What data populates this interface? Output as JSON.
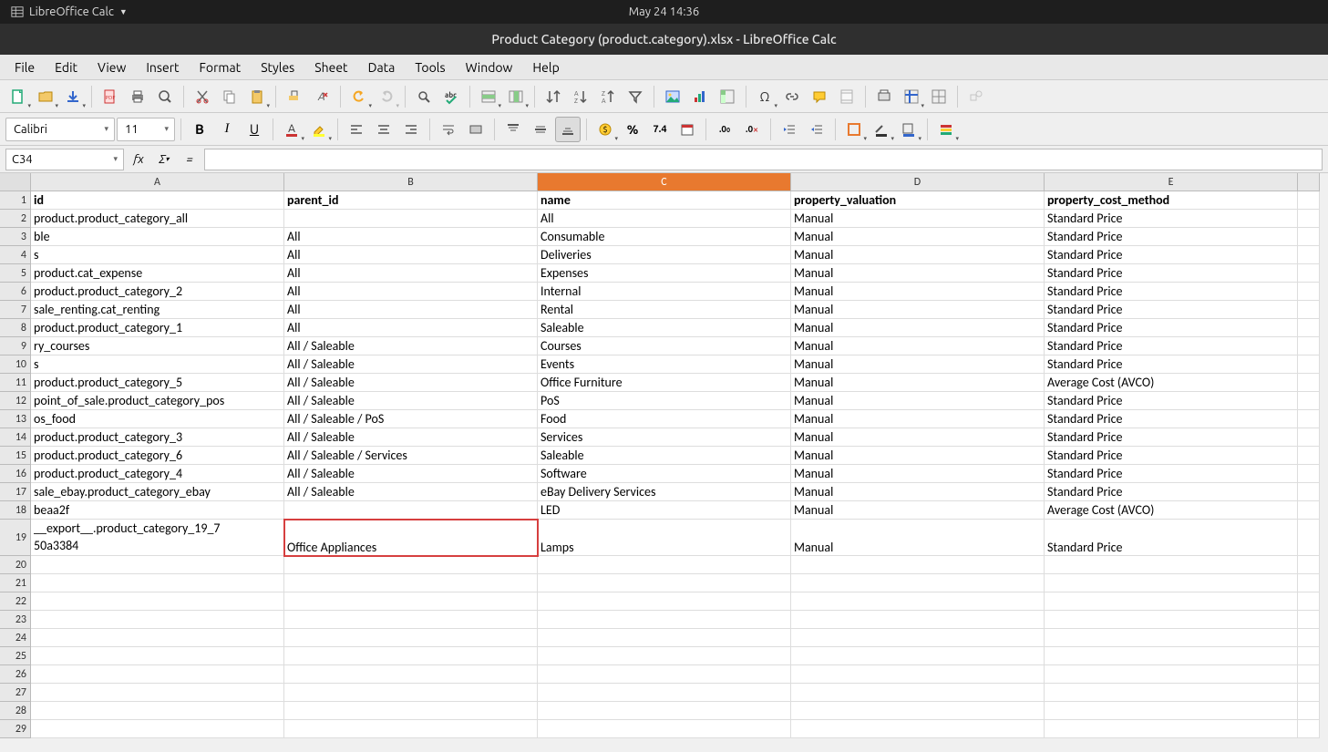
{
  "system": {
    "app_name": "LibreOffice Calc",
    "clock": "May 24  14:36"
  },
  "window": {
    "title": "Product Category (product.category).xlsx - LibreOffice Calc"
  },
  "menu": [
    "File",
    "Edit",
    "View",
    "Insert",
    "Format",
    "Styles",
    "Sheet",
    "Data",
    "Tools",
    "Window",
    "Help"
  ],
  "font": {
    "name": "Calibri",
    "size": "11"
  },
  "name_box": "C34",
  "columns": [
    "A",
    "B",
    "C",
    "D",
    "E"
  ],
  "active_column": "C",
  "headers": {
    "A": "id",
    "B": "parent_id",
    "C": "name",
    "D": "property_valuation",
    "E": "property_cost_method"
  },
  "rows": [
    {
      "n": "2",
      "A": "product.product_category_all",
      "B": "",
      "C": "All",
      "D": "Manual",
      "E": "Standard Price"
    },
    {
      "n": "3",
      "A": "ble",
      "B": "All",
      "C": "Consumable",
      "D": "Manual",
      "E": "Standard Price"
    },
    {
      "n": "4",
      "A": "s",
      "B": "All",
      "C": "Deliveries",
      "D": "Manual",
      "E": "Standard Price"
    },
    {
      "n": "5",
      "A": "product.cat_expense",
      "B": "All",
      "C": "Expenses",
      "D": "Manual",
      "E": "Standard Price"
    },
    {
      "n": "6",
      "A": "product.product_category_2",
      "B": "All",
      "C": "Internal",
      "D": "Manual",
      "E": "Standard Price"
    },
    {
      "n": "7",
      "A": "sale_renting.cat_renting",
      "B": "All",
      "C": "Rental",
      "D": "Manual",
      "E": "Standard Price"
    },
    {
      "n": "8",
      "A": "product.product_category_1",
      "B": "All",
      "C": "Saleable",
      "D": "Manual",
      "E": "Standard Price"
    },
    {
      "n": "9",
      "A": "ry_courses",
      "B": "All / Saleable",
      "C": "Courses",
      "D": "Manual",
      "E": "Standard Price"
    },
    {
      "n": "10",
      "A": "s",
      "B": "All / Saleable",
      "C": "Events",
      "D": "Manual",
      "E": "Standard Price"
    },
    {
      "n": "11",
      "A": "product.product_category_5",
      "B": "All / Saleable",
      "C": "Office Furniture",
      "D": "Manual",
      "E": "Average Cost (AVCO)"
    },
    {
      "n": "12",
      "A": "point_of_sale.product_category_pos",
      "B": "All / Saleable",
      "C": "PoS",
      "D": "Manual",
      "E": "Standard Price"
    },
    {
      "n": "13",
      "A": "os_food",
      "B": "All / Saleable / PoS",
      "C": "Food",
      "D": "Manual",
      "E": "Standard Price"
    },
    {
      "n": "14",
      "A": "product.product_category_3",
      "B": "All / Saleable",
      "C": "Services",
      "D": "Manual",
      "E": "Standard Price"
    },
    {
      "n": "15",
      "A": "product.product_category_6",
      "B": "All / Saleable / Services",
      "C": "Saleable",
      "D": "Manual",
      "E": "Standard Price"
    },
    {
      "n": "16",
      "A": "product.product_category_4",
      "B": "All / Saleable",
      "C": "Software",
      "D": "Manual",
      "E": "Standard Price"
    },
    {
      "n": "17",
      "A": "sale_ebay.product_category_ebay",
      "B": "All / Saleable",
      "C": "eBay Delivery Services",
      "D": "Manual",
      "E": "Standard Price"
    },
    {
      "n": "18",
      "A": "beaa2f",
      "B": "",
      "C": "LED",
      "D": "Manual",
      "E": "Average Cost (AVCO)"
    },
    {
      "n": "19",
      "A_line1": "__export__.product_category_19_7",
      "A_line2": "50a3384",
      "B": "Office Appliances",
      "C": "Lamps",
      "D": "Manual",
      "E": "Standard Price",
      "tall": true
    }
  ],
  "empty_rows": [
    "20",
    "21",
    "22",
    "23",
    "24",
    "25",
    "26",
    "27",
    "28",
    "29"
  ]
}
